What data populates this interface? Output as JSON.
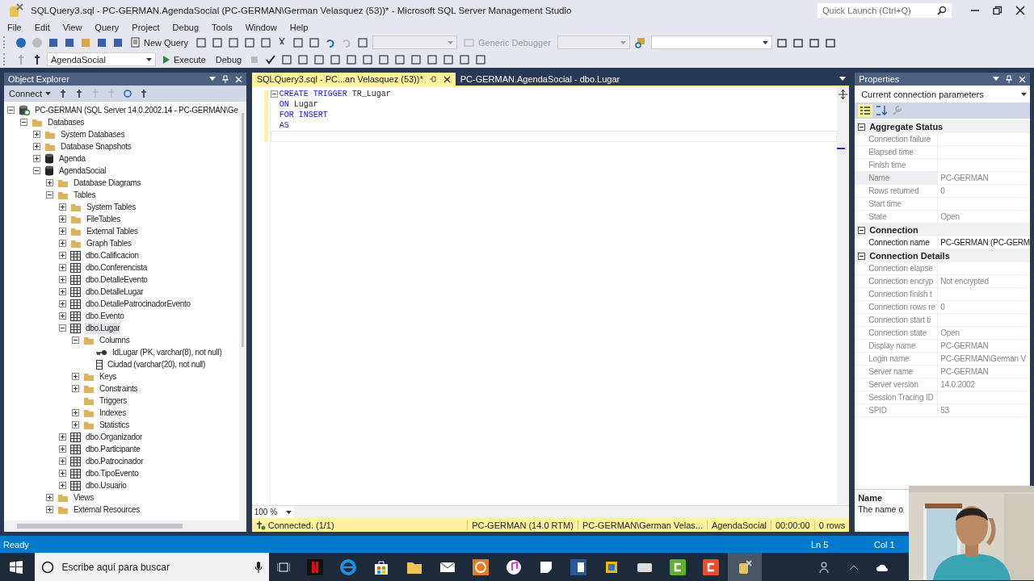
{
  "window": {
    "title": "SQLQuery3.sql - PC-GERMAN.AgendaSocial (PC-GERMAN\\German Velasquez (53))* - Microsoft SQL Server Management Studio"
  },
  "quick_launch": {
    "placeholder": "Quick Launch (Ctrl+Q)"
  },
  "menu": [
    "File",
    "Edit",
    "View",
    "Query",
    "Project",
    "Debug",
    "Tools",
    "Window",
    "Help"
  ],
  "toolbar": {
    "new_query": "New Query",
    "debugger": "Generic Debugger",
    "database": "AgendaSocial",
    "execute": "Execute",
    "debug": "Debug"
  },
  "object_explorer": {
    "title": "Object Explorer",
    "connect": "Connect",
    "tree": [
      {
        "label": "PC-GERMAN (SQL Server 14.0.2002.14 - PC-GERMAN\\Ge",
        "kind": "server",
        "expanded": true,
        "selected": false,
        "children": [
          {
            "label": "Databases",
            "kind": "folder",
            "expanded": true,
            "selected": false,
            "children": [
              {
                "label": "System Databases",
                "kind": "folder",
                "expanded": false,
                "selected": false
              },
              {
                "label": "Database Snapshots",
                "kind": "folder",
                "expanded": false,
                "selected": false
              },
              {
                "label": "Agenda",
                "kind": "database",
                "expanded": false,
                "selected": false
              },
              {
                "label": "AgendaSocial",
                "kind": "database",
                "expanded": true,
                "selected": false,
                "children": [
                  {
                    "label": "Database Diagrams",
                    "kind": "folder",
                    "expanded": false,
                    "selected": false
                  },
                  {
                    "label": "Tables",
                    "kind": "folder",
                    "expanded": true,
                    "selected": false,
                    "children": [
                      {
                        "label": "System Tables",
                        "kind": "folder",
                        "expanded": false,
                        "selected": false
                      },
                      {
                        "label": "FileTables",
                        "kind": "folder",
                        "expanded": false,
                        "selected": false
                      },
                      {
                        "label": "External Tables",
                        "kind": "folder",
                        "expanded": false,
                        "selected": false
                      },
                      {
                        "label": "Graph Tables",
                        "kind": "folder",
                        "expanded": false,
                        "selected": false
                      },
                      {
                        "label": "dbo.Calificacion",
                        "kind": "table",
                        "expanded": false,
                        "selected": false
                      },
                      {
                        "label": "dbo.Conferencista",
                        "kind": "table",
                        "expanded": false,
                        "selected": false
                      },
                      {
                        "label": "dbo.DetalleEvento",
                        "kind": "table",
                        "expanded": false,
                        "selected": false
                      },
                      {
                        "label": "dbo.DetalleLugar",
                        "kind": "table",
                        "expanded": false,
                        "selected": false
                      },
                      {
                        "label": "dbo.DetallePatrocinadorEvento",
                        "kind": "table",
                        "expanded": false,
                        "selected": false
                      },
                      {
                        "label": "dbo.Evento",
                        "kind": "table",
                        "expanded": false,
                        "selected": false
                      },
                      {
                        "label": "dbo.Lugar",
                        "kind": "table",
                        "expanded": true,
                        "selected": true,
                        "children": [
                          {
                            "label": "Columns",
                            "kind": "folder",
                            "expanded": true,
                            "selected": false,
                            "children": [
                              {
                                "label": "IdLugar (PK, varchar(8), not null)",
                                "kind": "key",
                                "selected": false
                              },
                              {
                                "label": "Ciudad (varchar(20), not null)",
                                "kind": "column",
                                "selected": false
                              }
                            ]
                          },
                          {
                            "label": "Keys",
                            "kind": "folder",
                            "expanded": false,
                            "selected": false
                          },
                          {
                            "label": "Constraints",
                            "kind": "folder",
                            "expanded": false,
                            "selected": false
                          },
                          {
                            "label": "Triggers",
                            "kind": "folder",
                            "selected": false
                          },
                          {
                            "label": "Indexes",
                            "kind": "folder",
                            "expanded": false,
                            "selected": false
                          },
                          {
                            "label": "Statistics",
                            "kind": "folder",
                            "expanded": false,
                            "selected": false
                          }
                        ]
                      },
                      {
                        "label": "dbo.Organizador",
                        "kind": "table",
                        "expanded": false,
                        "selected": false
                      },
                      {
                        "label": "dbo.Participante",
                        "kind": "table",
                        "expanded": false,
                        "selected": false
                      },
                      {
                        "label": "dbo.Patrocinador",
                        "kind": "table",
                        "expanded": false,
                        "selected": false
                      },
                      {
                        "label": "dbo.TipoEvento",
                        "kind": "table",
                        "expanded": false,
                        "selected": false
                      },
                      {
                        "label": "dbo.Usuario",
                        "kind": "table",
                        "expanded": false,
                        "selected": false
                      }
                    ]
                  },
                  {
                    "label": "Views",
                    "kind": "folder",
                    "expanded": false,
                    "selected": false
                  },
                  {
                    "label": "External Resources",
                    "kind": "folder",
                    "expanded": false,
                    "selected": false
                  }
                ]
              }
            ]
          }
        ]
      }
    ]
  },
  "editor": {
    "tabs": [
      {
        "label": "SQLQuery3.sql - PC...an Velasquez (53))*",
        "selected": true
      },
      {
        "label": "PC-GERMAN.AgendaSocial - dbo.Lugar",
        "selected": false
      }
    ],
    "lines": [
      [
        {
          "text": "CREATE TRIGGER",
          "kind": "keyword"
        },
        {
          "text": "TR_Lugar",
          "kind": "plain"
        }
      ],
      [
        {
          "text": "ON",
          "kind": "keyword"
        },
        {
          "text": "Lugar",
          "kind": "plain"
        }
      ],
      [
        {
          "text": "FOR",
          "kind": "keyword"
        },
        {
          "text": "INSERT",
          "kind": "keyword"
        }
      ],
      [
        {
          "text": "AS",
          "kind": "keyword"
        }
      ]
    ],
    "zoom": "100 %",
    "status": {
      "connection": "Connected. (1/1)",
      "server": "PC-GERMAN (14.0 RTM)",
      "user": "PC-GERMAN\\German Velas...",
      "database": "AgendaSocial",
      "time": "00:00:00",
      "rows": "0 rows"
    }
  },
  "properties": {
    "title": "Properties",
    "object": "Current connection parameters",
    "sections": [
      {
        "title": "Aggregate Status",
        "expanded": true,
        "rows": [
          {
            "name": "Connection failure",
            "value": "",
            "readonly": true,
            "selected": false
          },
          {
            "name": "Elapsed time",
            "value": "",
            "readonly": true,
            "selected": false
          },
          {
            "name": "Finish time",
            "value": "",
            "readonly": true,
            "selected": false
          },
          {
            "name": "Name",
            "value": "PC-GERMAN",
            "readonly": true,
            "selected": true
          },
          {
            "name": "Rows returned",
            "value": "0",
            "readonly": true,
            "selected": false
          },
          {
            "name": "Start time",
            "value": "",
            "readonly": true,
            "selected": false
          },
          {
            "name": "State",
            "value": "Open",
            "readonly": true,
            "selected": false
          }
        ]
      },
      {
        "title": "Connection",
        "expanded": true,
        "rows": [
          {
            "name": "Connection name",
            "value": "PC-GERMAN (PC-GERM",
            "readonly": false,
            "selected": false
          }
        ]
      },
      {
        "title": "Connection Details",
        "expanded": true,
        "rows": [
          {
            "name": "Connection elapse",
            "value": "",
            "readonly": true,
            "selected": false
          },
          {
            "name": "Connection encryp",
            "value": "Not encrypted",
            "readonly": true,
            "selected": false
          },
          {
            "name": "Connection finish t",
            "value": "",
            "readonly": true,
            "selected": false
          },
          {
            "name": "Connection rows re",
            "value": "0",
            "readonly": true,
            "selected": false
          },
          {
            "name": "Connection start ti",
            "value": "",
            "readonly": true,
            "selected": false
          },
          {
            "name": "Connection state",
            "value": "Open",
            "readonly": true,
            "selected": false
          },
          {
            "name": "Display name",
            "value": "PC-GERMAN",
            "readonly": true,
            "selected": false
          },
          {
            "name": "Login name",
            "value": "PC-GERMAN\\German V",
            "readonly": true,
            "selected": false
          },
          {
            "name": "Server name",
            "value": "PC-GERMAN",
            "readonly": true,
            "selected": false
          },
          {
            "name": "Server version",
            "value": "14.0.2002",
            "readonly": true,
            "selected": false
          },
          {
            "name": "Session Tracing ID",
            "value": "",
            "readonly": true,
            "selected": false
          },
          {
            "name": "SPID",
            "value": "53",
            "readonly": true,
            "selected": false
          }
        ]
      }
    ],
    "description": {
      "name": "Name",
      "text": "The name o"
    }
  },
  "status_bar": {
    "message": "Ready",
    "line": "Ln 5",
    "column": "Col 1"
  },
  "taskbar": {
    "search_placeholder": "Escribe aquí para buscar"
  }
}
